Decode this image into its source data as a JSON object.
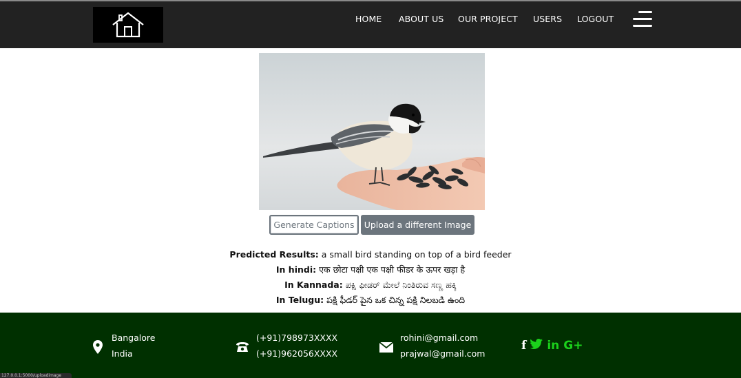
{
  "nav": {
    "links": [
      {
        "label": "HOME"
      },
      {
        "label": "ABOUT US"
      },
      {
        "label": "OUR PROJECT"
      },
      {
        "label": "USERS"
      },
      {
        "label": "LOGOUT"
      }
    ]
  },
  "buttons": {
    "generate": "Generate Captions",
    "upload": "Upload a different Image"
  },
  "results": {
    "predicted_label": "Predicted Results:",
    "predicted_text": "a small bird standing on top of a bird feeder",
    "hindi_label": "In hindi:",
    "hindi_text": "एक छोटा पक्षी एक पक्षी फीडर के ऊपर खड़ा है",
    "kannada_label": "In Kannada:",
    "kannada_text": "ಪಕ್ಷಿ ಫೀಡರ್ ಮೇಲೆ ನಿಂತಿರುವ ಸಣ್ಣ ಹಕ್ಕಿ",
    "telugu_label": "In Telugu:",
    "telugu_text": "పక్షి ఫీడర్ పైన ఒక చిన్న పక్షి నిలబడి ఉంది"
  },
  "footer": {
    "address": [
      "Bangalore",
      "India"
    ],
    "phones": [
      "(+91)798973XXXX",
      "(+91)962056XXXX"
    ],
    "emails": [
      "rohini@gmail.com",
      "prajwal@gmail.com"
    ],
    "social": {
      "facebook": "f",
      "linkedin": "in",
      "googleplus": "G+"
    }
  },
  "statusbar": {
    "text": "127.0.0.1:5000/uploadimage"
  },
  "colors": {
    "navbar": "#222222",
    "footer": "#003000",
    "social_accent": "#1bd11b",
    "secondary_button": "#6c757d"
  },
  "icons": {
    "logo": "house-icon",
    "menu": "hamburger-menu-icon",
    "address": "map-pin-icon",
    "phone": "telephone-icon",
    "email": "envelope-icon",
    "social": [
      "facebook-icon",
      "twitter-icon",
      "linkedin-icon",
      "google-plus-icon"
    ]
  }
}
